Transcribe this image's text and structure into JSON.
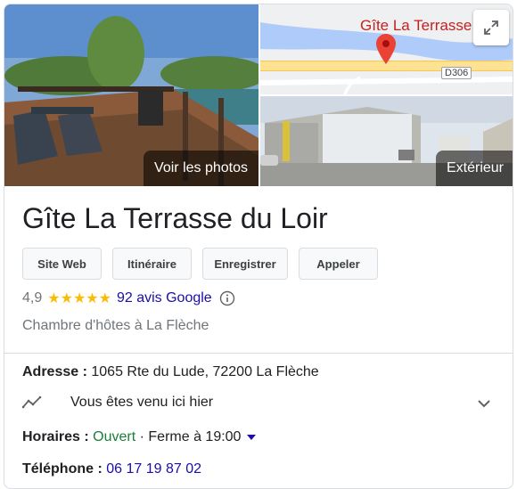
{
  "photos": {
    "main_label": "Voir les photos",
    "exterior_label": "Extérieur",
    "map_title": "Gîte La Terrasse d",
    "road_tag": "D306"
  },
  "place": {
    "name": "Gîte La Terrasse du Loir",
    "category": "Chambre d'hôtes à La Flèche"
  },
  "actions": {
    "website": "Site Web",
    "directions": "Itinéraire",
    "save": "Enregistrer",
    "call": "Appeler"
  },
  "rating": {
    "score": "4,9",
    "stars": "★★★★★",
    "reviews": "92 avis Google"
  },
  "details": {
    "address_label": "Adresse :",
    "address_value": "1065 Rte du Lude, 72200 La Flèche",
    "visited_text": "Vous êtes venu ici hier",
    "hours_label": "Horaires :",
    "hours_status": "Ouvert",
    "hours_detail": "· Ferme à 19:00",
    "phone_label": "Téléphone :",
    "phone_value": "06 17 19 87 02"
  },
  "colors": {
    "link": "#1a0dab",
    "open": "#188038",
    "star": "#fbbc04",
    "pin": "#ea4335"
  }
}
